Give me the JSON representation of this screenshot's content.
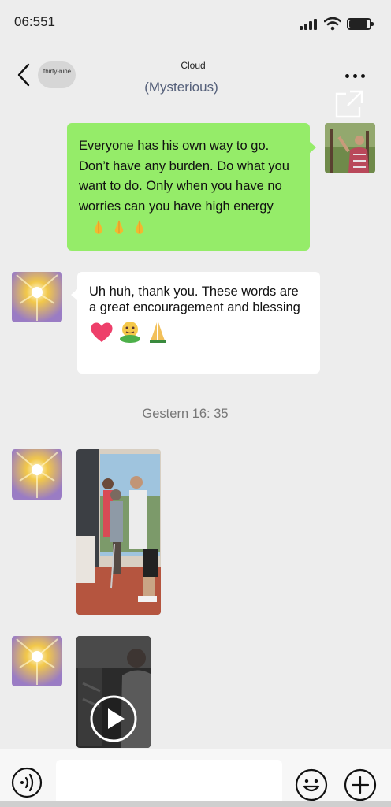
{
  "status_bar": {
    "time": "06:551"
  },
  "header": {
    "badge_text": "thirty-nine",
    "title": "Cloud",
    "subtitle": "(Mysterious)"
  },
  "messages": {
    "sent": {
      "text": "Everyone has his own way to go. Don’t have any burden. Do what you want to do. Only when you have no worries can you have high energy",
      "emojis": [
        "pray-emoji",
        "pray-emoji",
        "pray-emoji"
      ]
    },
    "received": {
      "text": "Uh huh, thank you. These words are a great encouragement and blessing",
      "emojis": [
        "heart-emoji",
        "hug-emoji",
        "pray-emoji"
      ]
    },
    "timestamp": "Gestern 16: 35"
  },
  "input_bar": {
    "placeholder": ""
  },
  "colors": {
    "sent_bubble": "#95ec69",
    "background": "#ededed",
    "received_bubble": "#ffffff"
  }
}
